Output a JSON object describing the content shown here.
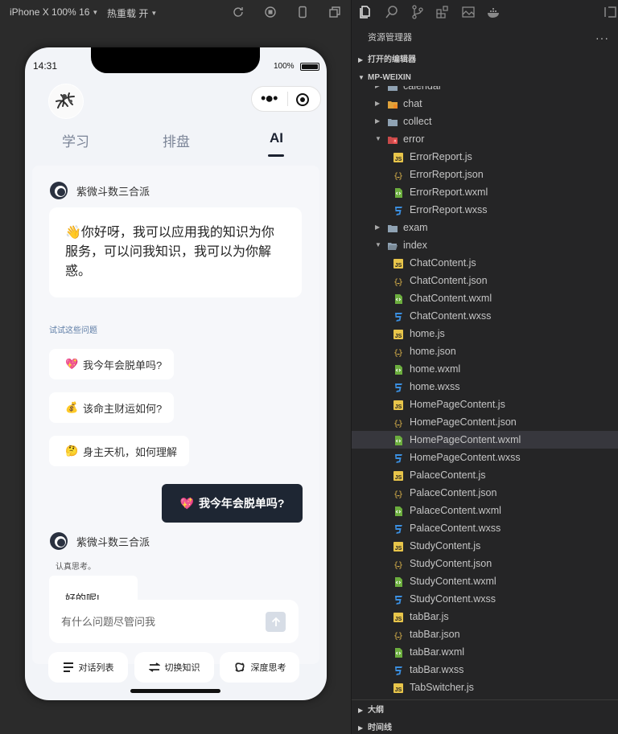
{
  "simulator": {
    "device": "iPhone X 100% 16",
    "hot_reload": "热重载 开"
  },
  "phone": {
    "status_time": "14:31",
    "battery_percent": "100%",
    "tabs": [
      "学习",
      "排盘",
      "AI"
    ],
    "active_tab": "AI",
    "bot_name": "紫微斗数三合派",
    "welcome_text": "👋你好呀，我可以应用我的知识为你服务，可以问我知识，我可以为你解惑。",
    "suggest_title": "试试这些问题",
    "suggestions": [
      {
        "emoji": "💖",
        "text": "我今年会脱单吗?"
      },
      {
        "emoji": "💰",
        "text": "该命主财运如何?"
      },
      {
        "emoji": "🤔",
        "text": "身主天机，如何理解"
      }
    ],
    "user_message": {
      "emoji": "💖",
      "text": "我今年会脱单吗?"
    },
    "thinking_label": "认真思考。",
    "reply_partial": "好的呢!",
    "input_placeholder": "有什么问题尽管问我",
    "bottom_buttons": [
      "对话列表",
      "切换知识",
      "深度思考"
    ]
  },
  "explorer": {
    "title": "资源管理器",
    "open_editors": "打开的编辑器",
    "project": "MP-WEIXIN",
    "outline": "大纲",
    "timeline": "时间线",
    "selected_file": "HomePageContent.wxml",
    "tree": [
      {
        "name": "calendar",
        "type": "folder",
        "depth": 1,
        "expanded": false
      },
      {
        "name": "chat",
        "type": "folder-special",
        "depth": 1,
        "expanded": false
      },
      {
        "name": "collect",
        "type": "folder",
        "depth": 1,
        "expanded": false
      },
      {
        "name": "error",
        "type": "folder-error",
        "depth": 1,
        "expanded": true
      },
      {
        "name": "ErrorReport.js",
        "type": "js",
        "depth": 2
      },
      {
        "name": "ErrorReport.json",
        "type": "json",
        "depth": 2
      },
      {
        "name": "ErrorReport.wxml",
        "type": "wxml",
        "depth": 2
      },
      {
        "name": "ErrorReport.wxss",
        "type": "wxss",
        "depth": 2
      },
      {
        "name": "exam",
        "type": "folder",
        "depth": 1,
        "expanded": false
      },
      {
        "name": "index",
        "type": "folder-open",
        "depth": 1,
        "expanded": true
      },
      {
        "name": "ChatContent.js",
        "type": "js",
        "depth": 2
      },
      {
        "name": "ChatContent.json",
        "type": "json",
        "depth": 2
      },
      {
        "name": "ChatContent.wxml",
        "type": "wxml",
        "depth": 2
      },
      {
        "name": "ChatContent.wxss",
        "type": "wxss",
        "depth": 2
      },
      {
        "name": "home.js",
        "type": "js",
        "depth": 2
      },
      {
        "name": "home.json",
        "type": "json",
        "depth": 2
      },
      {
        "name": "home.wxml",
        "type": "wxml",
        "depth": 2
      },
      {
        "name": "home.wxss",
        "type": "wxss",
        "depth": 2
      },
      {
        "name": "HomePageContent.js",
        "type": "js",
        "depth": 2
      },
      {
        "name": "HomePageContent.json",
        "type": "json",
        "depth": 2
      },
      {
        "name": "HomePageContent.wxml",
        "type": "wxml",
        "depth": 2
      },
      {
        "name": "HomePageContent.wxss",
        "type": "wxss",
        "depth": 2
      },
      {
        "name": "PalaceContent.js",
        "type": "js",
        "depth": 2
      },
      {
        "name": "PalaceContent.json",
        "type": "json",
        "depth": 2
      },
      {
        "name": "PalaceContent.wxml",
        "type": "wxml",
        "depth": 2
      },
      {
        "name": "PalaceContent.wxss",
        "type": "wxss",
        "depth": 2
      },
      {
        "name": "StudyContent.js",
        "type": "js",
        "depth": 2
      },
      {
        "name": "StudyContent.json",
        "type": "json",
        "depth": 2
      },
      {
        "name": "StudyContent.wxml",
        "type": "wxml",
        "depth": 2
      },
      {
        "name": "StudyContent.wxss",
        "type": "wxss",
        "depth": 2
      },
      {
        "name": "tabBar.js",
        "type": "js",
        "depth": 2
      },
      {
        "name": "tabBar.json",
        "type": "json",
        "depth": 2
      },
      {
        "name": "tabBar.wxml",
        "type": "wxml",
        "depth": 2
      },
      {
        "name": "tabBar.wxss",
        "type": "wxss",
        "depth": 2
      },
      {
        "name": "TabSwitcher.js",
        "type": "js",
        "depth": 2
      }
    ]
  },
  "colors": {
    "js": "#e8c54a",
    "json": "#d7b04a",
    "wxml": "#6cae3e",
    "wxss": "#3b8fe0",
    "folder": "#8fa2b3",
    "selected_row": "#37373d"
  }
}
